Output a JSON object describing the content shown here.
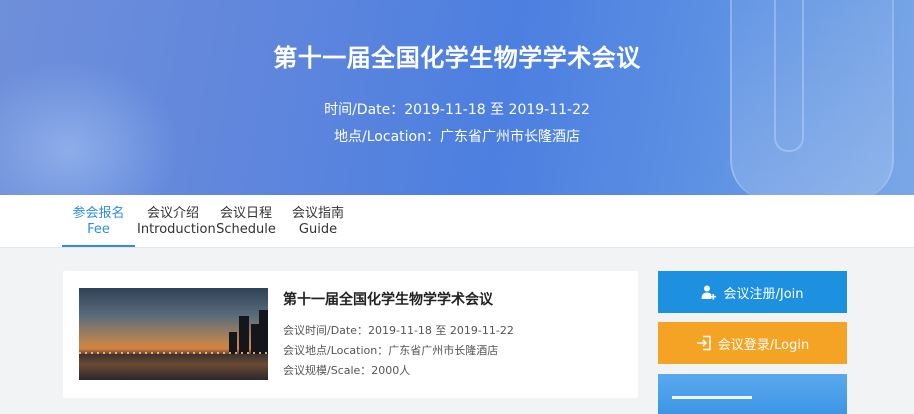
{
  "banner": {
    "title": "第十一届全国化学生物学学术会议",
    "date": "时间/Date：2019-11-18 至 2019-11-22",
    "location": "地点/Location：广东省广州市长隆酒店"
  },
  "nav": {
    "tabs": [
      {
        "cn": "参会报名",
        "en": "Fee",
        "active": true
      },
      {
        "cn": "会议介绍",
        "en": "Introduction",
        "active": false
      },
      {
        "cn": "会议日程",
        "en": "Schedule",
        "active": false
      },
      {
        "cn": "会议指南",
        "en": "Guide",
        "active": false
      }
    ]
  },
  "card": {
    "title": "第十一届全国化学生物学学术会议",
    "date": "会议时间/Date：2019-11-18 至 2019-11-22",
    "location": "会议地点/Location：广东省广州市长隆酒店",
    "scale": "会议规模/Scale：2000人"
  },
  "sidebar": {
    "register_label": "会议注册/Join",
    "login_label": "会议登录/Login",
    "register_icon": "add-user-icon",
    "login_icon": "login-icon"
  },
  "colors": {
    "accent": "#2b8ee0",
    "register_button": "#1e90e0",
    "login_button": "#f5a325"
  }
}
